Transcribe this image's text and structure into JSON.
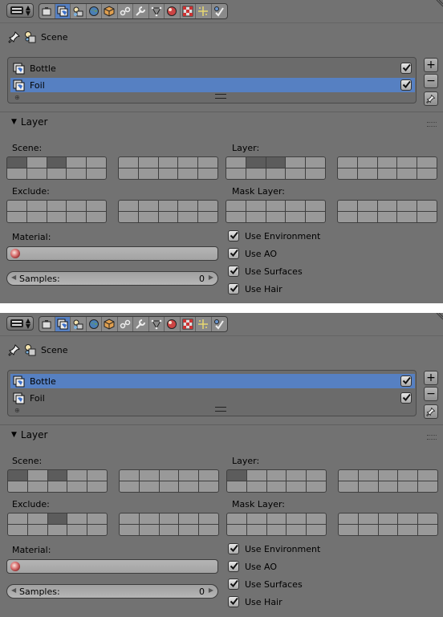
{
  "panels": [
    {
      "id": "top",
      "selected_index": 1,
      "scene_label": "Scene",
      "render_layers": [
        {
          "name": "Bottle",
          "enabled": true
        },
        {
          "name": "Foil",
          "enabled": true
        }
      ],
      "layer_section": {
        "title": "Layer",
        "scene_label": "Scene:",
        "layer_label": "Layer:",
        "exclude_label": "Exclude:",
        "mask_label": "Mask Layer:",
        "scene_on": [
          0,
          2
        ],
        "layer_on": [
          1,
          2
        ],
        "exclude_on": [],
        "mask_on": []
      },
      "material_label": "Material:",
      "samples": {
        "label": "Samples:",
        "value": "0"
      },
      "options": [
        {
          "label": "Use Environment",
          "checked": true
        },
        {
          "label": "Use AO",
          "checked": true
        },
        {
          "label": "Use Surfaces",
          "checked": true
        },
        {
          "label": "Use Hair",
          "checked": true
        }
      ]
    },
    {
      "id": "bottom",
      "selected_index": 0,
      "scene_label": "Scene",
      "render_layers": [
        {
          "name": "Bottle",
          "enabled": true
        },
        {
          "name": "Foil",
          "enabled": true
        }
      ],
      "layer_section": {
        "title": "Layer",
        "scene_label": "Scene:",
        "layer_label": "Layer:",
        "exclude_label": "Exclude:",
        "mask_label": "Mask Layer:",
        "scene_on": [
          0,
          2
        ],
        "layer_on": [
          0
        ],
        "exclude_on": [
          2
        ],
        "mask_on": []
      },
      "material_label": "Material:",
      "samples": {
        "label": "Samples:",
        "value": "0"
      },
      "options": [
        {
          "label": "Use Environment",
          "checked": true
        },
        {
          "label": "Use AO",
          "checked": true
        },
        {
          "label": "Use Surfaces",
          "checked": true
        },
        {
          "label": "Use Hair",
          "checked": true
        }
      ]
    }
  ],
  "context_tabs": [
    {
      "icon": "render-camera-icon",
      "active": false
    },
    {
      "icon": "render-layers-icon",
      "active": true
    },
    {
      "icon": "scene-icon",
      "active": false
    },
    {
      "icon": "world-icon",
      "active": false
    },
    {
      "icon": "object-icon",
      "active": false
    },
    {
      "icon": "constraints-icon",
      "active": false
    },
    {
      "icon": "modifier-wrench-icon",
      "active": false
    },
    {
      "icon": "data-vertices-icon",
      "active": false
    },
    {
      "icon": "material-icon",
      "active": false
    },
    {
      "icon": "texture-icon",
      "active": false
    },
    {
      "icon": "particles-icon",
      "active": false
    },
    {
      "icon": "physics-icon",
      "active": false
    }
  ],
  "colors": {
    "panel": "#727272",
    "selection": "#5680c2",
    "cell_on": "#5c5c5c",
    "cell_off": "#999999"
  }
}
